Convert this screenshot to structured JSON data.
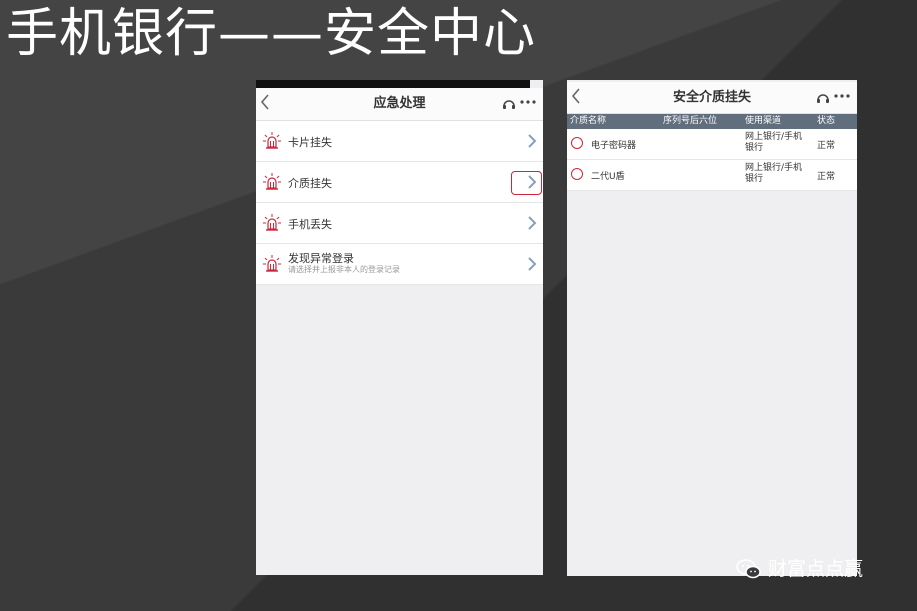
{
  "slide": {
    "title": "手机银行——安全中心"
  },
  "phone1": {
    "nav": {
      "title": "应急处理",
      "back_icon": "chevron-left-icon",
      "refresh_icon": "headset-icon",
      "more_icon": "more-dots-icon"
    },
    "items": [
      {
        "label": "卡片挂失",
        "icon": "alarm-light-icon"
      },
      {
        "label": "介质挂失",
        "icon": "alarm-light-icon",
        "highlighted": true
      },
      {
        "label": "手机丢失",
        "icon": "alarm-light-icon"
      },
      {
        "label": "发现异常登录",
        "sub": "请选择并上报非本人的登录记录",
        "icon": "alarm-light-icon"
      }
    ]
  },
  "phone2": {
    "nav": {
      "title": "安全介质挂失",
      "back_icon": "chevron-left-icon",
      "refresh_icon": "headset-icon",
      "more_icon": "more-dots-icon"
    },
    "table": {
      "headers": [
        "介质名称",
        "序列号后六位",
        "使用渠道",
        "状态"
      ],
      "rows": [
        {
          "name": "电子密码器",
          "serial": "",
          "channel": "网上银行/手机银行",
          "status": "正常"
        },
        {
          "name": "二代U盾",
          "serial": "",
          "channel": "网上银行/手机银行",
          "status": "正常"
        }
      ]
    }
  },
  "watermark": {
    "text": "财富点点赢",
    "icon": "wechat-icon"
  },
  "colors": {
    "accent_red": "#d0263b",
    "table_header": "#616e7e",
    "background": "#3a3a3a"
  }
}
